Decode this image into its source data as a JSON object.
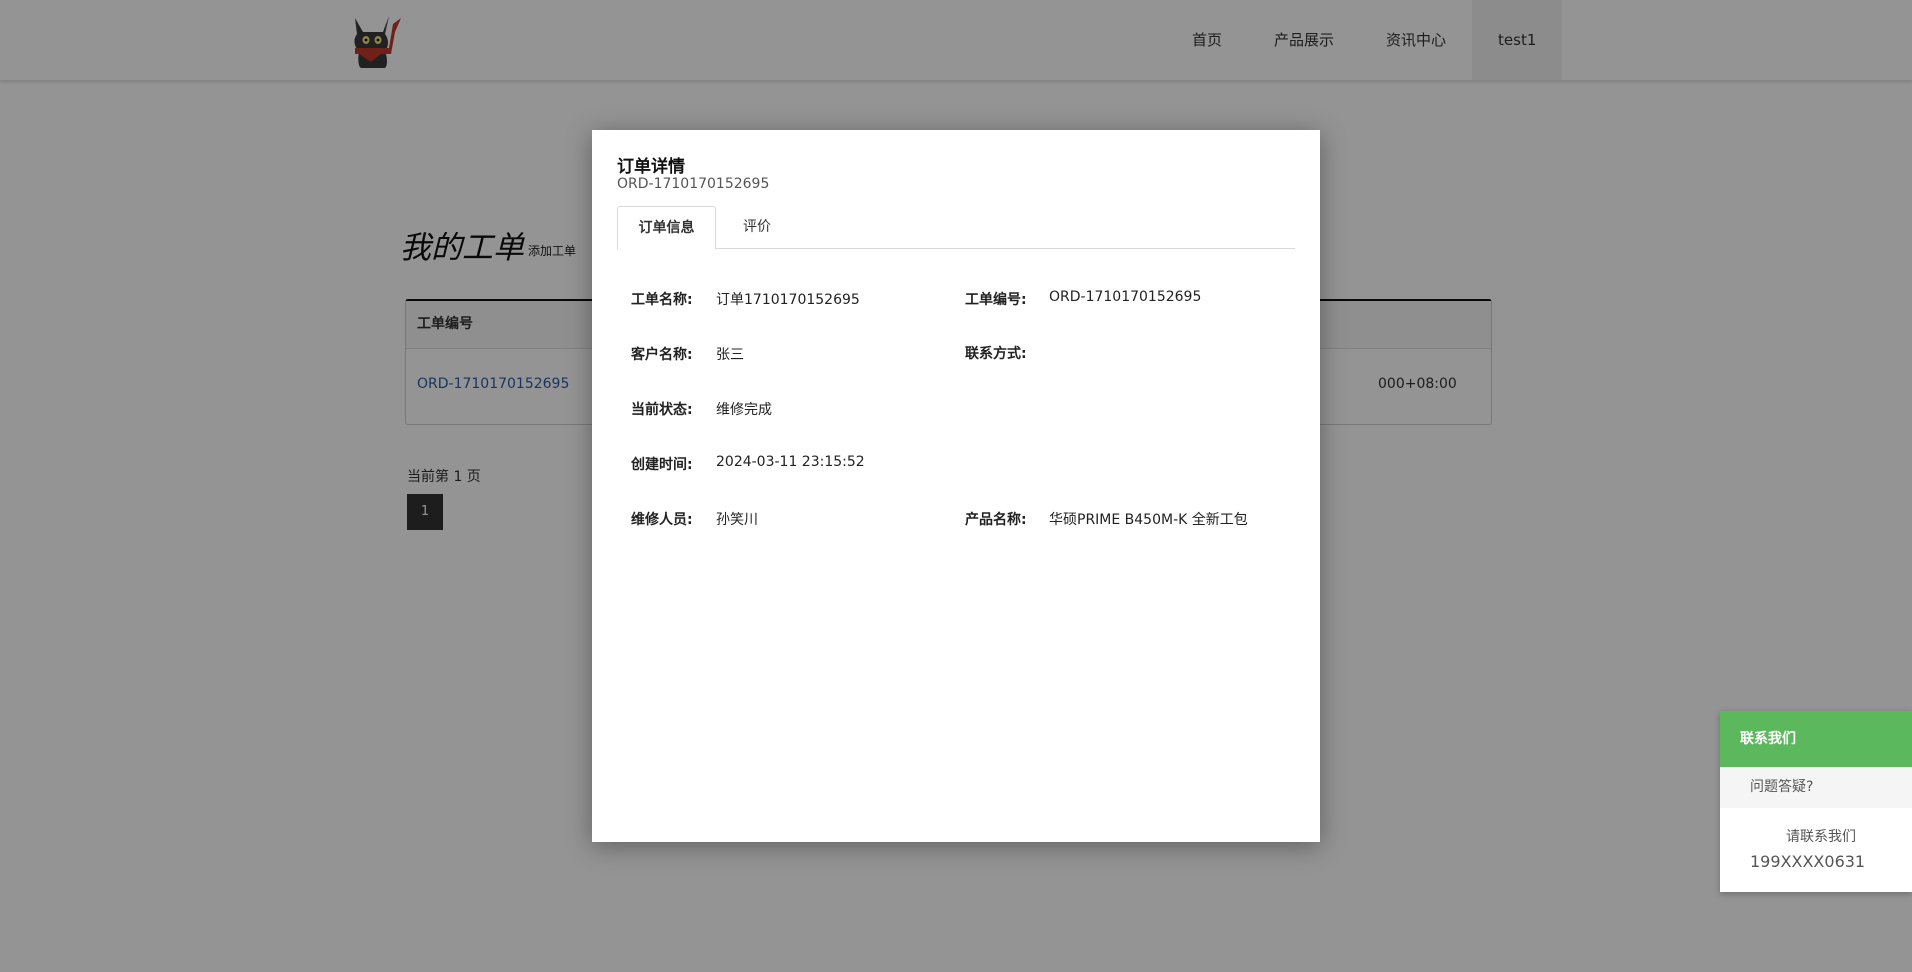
{
  "nav": {
    "items": [
      "首页",
      "产品展示",
      "资讯中心",
      "test1"
    ],
    "active_index": 3
  },
  "page": {
    "title": "我的工单",
    "add_link": "添加工单",
    "table": {
      "headers": [
        "工单编号"
      ],
      "row": {
        "order_no": "ORD-1710170152695",
        "timestamp_fragment": "000+08:00"
      }
    },
    "pager": {
      "text": "当前第 1  页",
      "current": "1"
    }
  },
  "modal": {
    "title": "订单详情",
    "subtitle": "ORD-1710170152695",
    "tabs": [
      "订单信息",
      "评价"
    ],
    "active_tab": 0,
    "fields": {
      "work_name_label": "工单名称:",
      "work_name_value": "订单1710170152695",
      "work_no_label": "工单编号:",
      "work_no_value": "ORD-1710170152695",
      "customer_label": "客户名称:",
      "customer_value": "张三",
      "contact_label": "联系方式:",
      "contact_value": "",
      "status_label": "当前状态:",
      "status_value": "维修完成",
      "created_label": "创建时间:",
      "created_value": "2024-03-11 23:15:52",
      "repairer_label": "维修人员:",
      "repairer_value": "孙笑川",
      "product_label": "产品名称:",
      "product_value": "华硕PRIME B450M-K 全新工包"
    }
  },
  "contact_widget": {
    "header": "联系我们",
    "question": "问题答疑?",
    "please": "请联系我们",
    "phone": "199XXXX0631"
  },
  "colors": {
    "overlay": "rgba(0,0,0,0.42)",
    "accent_green": "#5cb85c",
    "link_blue": "#2a5ea8"
  }
}
